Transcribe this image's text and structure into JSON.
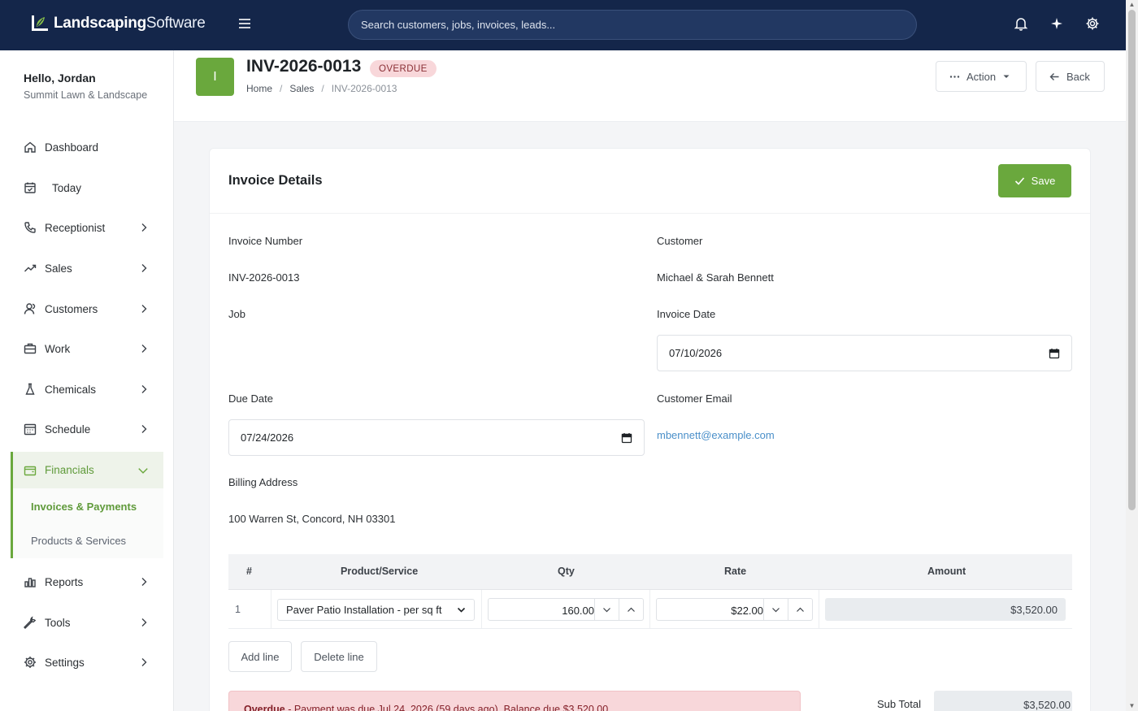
{
  "brand": {
    "name_bold": "Landscaping",
    "name_light": "Software",
    "accent": "#6aa83d",
    "navy": "#14264a"
  },
  "search": {
    "placeholder": "Search customers, jobs, invoices, leads..."
  },
  "user": {
    "greeting": "Hello, Jordan",
    "company": "Summit Lawn & Landscape"
  },
  "sidebar": {
    "items": [
      {
        "label": "Dashboard",
        "icon": "home-icon"
      },
      {
        "label": "Today",
        "icon": "calendar-check-icon"
      },
      {
        "label": "Receptionist",
        "icon": "phone-icon"
      },
      {
        "label": "Sales",
        "icon": "trend-icon"
      },
      {
        "label": "Customers",
        "icon": "users-icon"
      },
      {
        "label": "Work",
        "icon": "briefcase-icon"
      },
      {
        "label": "Chemicals",
        "icon": "flask-icon"
      },
      {
        "label": "Schedule",
        "icon": "calendar-grid-icon"
      },
      {
        "label": "Financials",
        "icon": "wallet-icon"
      },
      {
        "label": "Reports",
        "icon": "bar-chart-icon"
      },
      {
        "label": "Tools",
        "icon": "wrench-icon"
      },
      {
        "label": "Settings",
        "icon": "gear-icon"
      }
    ],
    "financials_sub": [
      "Invoices & Payments",
      "Products & Services"
    ]
  },
  "header": {
    "avatar_letter": "I",
    "title": "INV-2026-0013",
    "status": "OVERDUE",
    "breadcrumb": [
      "Home",
      "Sales",
      "INV-2026-0013"
    ],
    "action_label": "Action",
    "back_label": "Back"
  },
  "card": {
    "title": "Invoice Details",
    "save_label": "Save",
    "fields": {
      "invoice_number_label": "Invoice Number",
      "invoice_number": "INV-2026-0013",
      "customer_label": "Customer",
      "customer": "Michael & Sarah Bennett",
      "job_label": "Job",
      "invoice_date_label": "Invoice Date",
      "invoice_date": "07/10/2026",
      "due_date_label": "Due Date",
      "due_date": "07/24/2026",
      "customer_email_label": "Customer Email",
      "customer_email": "mbennett@example.com",
      "billing_address_label": "Billing Address",
      "billing_address": "100 Warren St, Concord, NH 03301"
    },
    "table": {
      "headers": [
        "#",
        "Product/Service",
        "Qty",
        "Rate",
        "Amount"
      ],
      "rows": [
        {
          "num": "1",
          "product": "Paver Patio Installation - per sq ft",
          "qty": "160.00",
          "rate": "$22.00",
          "amount": "$3,520.00"
        }
      ]
    },
    "add_line": "Add line",
    "delete_line": "Delete line",
    "alert": {
      "title": "Overdue",
      "message": "- Payment was due Jul 24, 2026 (59 days ago). Balance due $3,520.00"
    },
    "subtotal_label": "Sub Total",
    "subtotal": "$3,520.00"
  }
}
